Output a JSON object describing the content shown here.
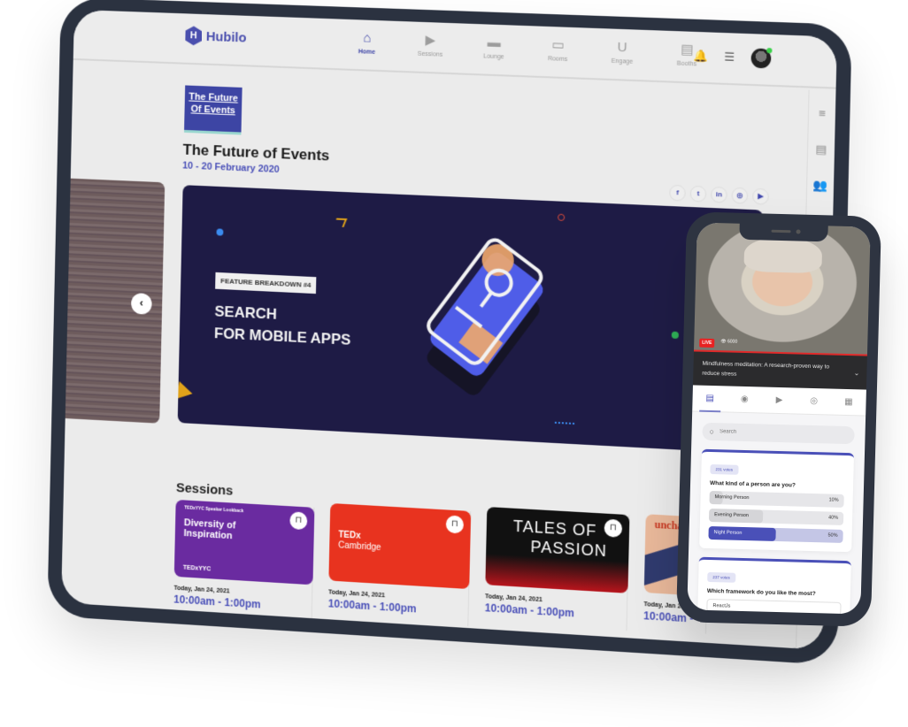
{
  "app": {
    "brand": "Hubilo",
    "logo_letter": "H"
  },
  "nav": {
    "items": [
      {
        "label": "Home",
        "icon": "home-icon",
        "glyph": "⌂",
        "active": true
      },
      {
        "label": "Sessions",
        "icon": "video-camera-icon",
        "glyph": "▶"
      },
      {
        "label": "Lounge",
        "icon": "armchair-icon",
        "glyph": "▬"
      },
      {
        "label": "Rooms",
        "icon": "monitor-icon",
        "glyph": "▭"
      },
      {
        "label": "Engage",
        "icon": "magnet-icon",
        "glyph": "U"
      },
      {
        "label": "Booths",
        "icon": "booth-icon",
        "glyph": "▤"
      }
    ]
  },
  "top_actions": {
    "bell_glyph": "🔔",
    "chat_glyph": "☰"
  },
  "right_rail": {
    "menu_glyph": "≡",
    "agenda_glyph": "▤",
    "people_glyph": "👥"
  },
  "event": {
    "thumb_line1": "The Future",
    "thumb_line2": "Of Events",
    "title": "The Future of Events",
    "dates": "10 - 20 February 2020"
  },
  "socials": [
    {
      "name": "facebook",
      "glyph": "f"
    },
    {
      "name": "twitter",
      "glyph": "t"
    },
    {
      "name": "linkedin",
      "glyph": "in"
    },
    {
      "name": "instagram",
      "glyph": "◎"
    },
    {
      "name": "youtube",
      "glyph": "▶"
    }
  ],
  "banner": {
    "tag": "FEATURE BREAKDOWN #4",
    "title_line1": "SEARCH",
    "title_line2": "FOR MOBILE APPS",
    "prev_glyph": "‹"
  },
  "sessions": {
    "title": "Sessions",
    "cards": [
      {
        "image_text": "Diversity of Inspiration",
        "image_subtext": "TEDxYYC Speaker Lookback",
        "brand": "TEDxYYC",
        "color": "#6a2ba0",
        "date": "Today, Jan 24, 2021",
        "time": "10:00am - 1:00pm"
      },
      {
        "image_text": "TEDx",
        "image_subtext": "Cambridge",
        "brand": "",
        "color": "#e8331f",
        "date": "Today, Jan 24, 2021",
        "time": "10:00am - 1:00pm"
      },
      {
        "image_text": "TALES OF",
        "image_subtext": "PASSION",
        "brand": "",
        "color": "#111111",
        "date": "Today, Jan 24, 2021",
        "time": "10:00am - 1:00pm"
      },
      {
        "image_text": "uncha",
        "image_subtext": "",
        "brand": "",
        "color": "#e9b89a",
        "date": "Today, Jan 24, 2",
        "time": "10:00am -"
      }
    ],
    "bookmark_glyph": "⊓"
  },
  "phone": {
    "live_label": "LIVE",
    "viewers": "👁 6000",
    "caption": "Mindfulness meditation: A research-proven way to reduce stress",
    "caption_chevron": "⌄",
    "tabs": [
      {
        "name": "polls",
        "glyph": "▤",
        "active": true
      },
      {
        "name": "qna",
        "glyph": "◉"
      },
      {
        "name": "video",
        "glyph": "▶"
      },
      {
        "name": "viewers",
        "glyph": "◎"
      },
      {
        "name": "calendar",
        "glyph": "▦"
      }
    ],
    "search_placeholder": "Search",
    "search_glyph": "○",
    "polls": [
      {
        "votes": "231 votes",
        "question": "What kind of a person are you?",
        "options": [
          {
            "label": "Morning Person",
            "percent": 10,
            "pct_label": "10%"
          },
          {
            "label": "Evening Person",
            "percent": 40,
            "pct_label": "40%"
          },
          {
            "label": "Night Person",
            "percent": 50,
            "pct_label": "50%",
            "selected": true
          }
        ]
      },
      {
        "votes": "237 votes",
        "question": "Which framework do you like the most?",
        "options": [
          {
            "label": "ReactJs"
          }
        ]
      }
    ]
  },
  "colors": {
    "brand": "#4a50b8",
    "banner_bg": "#1e1b45",
    "live": "#e82222",
    "frame": "#2b3240"
  }
}
